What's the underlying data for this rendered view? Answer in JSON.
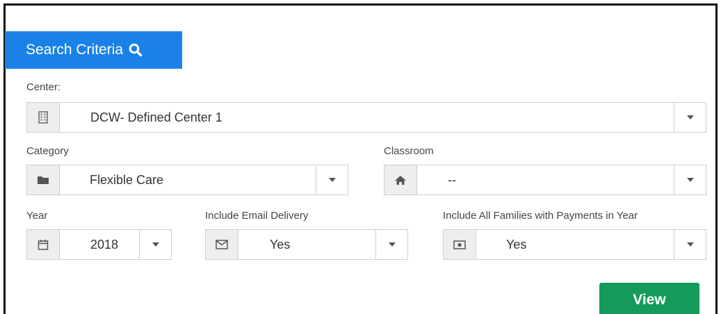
{
  "header": {
    "title": "Search Criteria",
    "icon": "search-icon"
  },
  "center": {
    "label": "Center:",
    "value": "DCW- Defined Center 1",
    "icon": "building-icon"
  },
  "category": {
    "label": "Category",
    "value": "Flexible Care",
    "icon": "folder-icon"
  },
  "classroom": {
    "label": "Classroom",
    "value": "--",
    "icon": "home-icon"
  },
  "year": {
    "label": "Year",
    "value": "2018",
    "icon": "calendar-icon"
  },
  "email_delivery": {
    "label": "Include Email Delivery",
    "value": "Yes",
    "icon": "envelope-icon"
  },
  "all_families": {
    "label": "Include All Families with Payments in Year",
    "value": "Yes",
    "icon": "money-icon"
  },
  "actions": {
    "view_label": "View"
  },
  "colors": {
    "header_bg": "#1a82e6",
    "view_bg": "#149a5a",
    "addon_bg": "#eeeeee"
  }
}
